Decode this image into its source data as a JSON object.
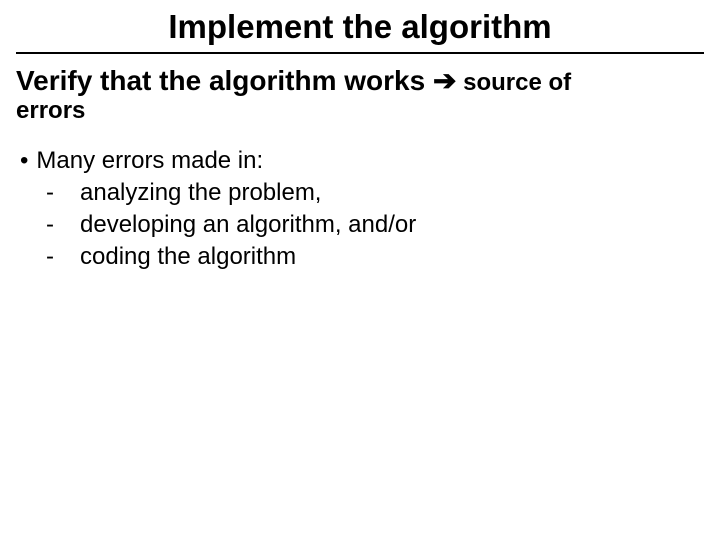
{
  "title": "Implement the algorithm",
  "subtitle": {
    "lead": "Verify that the algorithm works ",
    "arrow": "➔",
    "trail1": " source of",
    "trail2": "errors"
  },
  "bullets": [
    {
      "mark": "•",
      "text": "Many errors made in:"
    }
  ],
  "dashes": [
    {
      "mark": "-",
      "text": "analyzing the problem,"
    },
    {
      "mark": "-",
      "text": "developing an algorithm, and/or"
    },
    {
      "mark": "-",
      "text": "coding the algorithm"
    }
  ]
}
